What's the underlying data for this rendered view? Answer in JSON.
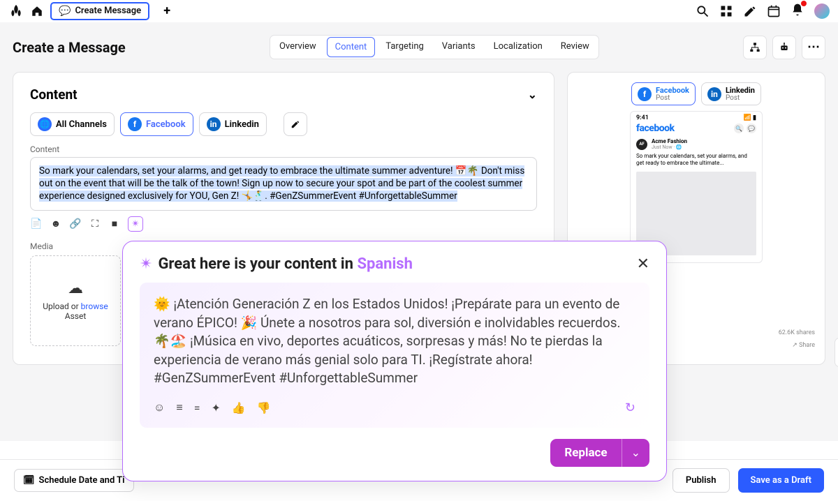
{
  "topbar": {
    "tab_label": "Create Message"
  },
  "page": {
    "title": "Create a Message"
  },
  "nav": {
    "tabs": [
      "Overview",
      "Content",
      "Targeting",
      "Variants",
      "Localization",
      "Review"
    ],
    "active": 1
  },
  "content_card": {
    "heading": "Content",
    "channels": {
      "all_label": "All Channels",
      "fb_label": "Facebook",
      "li_label": "Linkedin"
    },
    "field_label": "Content",
    "message": "So mark your calendars, set your alarms, and get ready to embrace the ultimate summer adventure! 📅🌴 Don't miss out on the event that will be the talk of the town! Sign up now to secure your spot and be part of the coolest summer experience designed exclusively for YOU, Gen Z! 🤸🕺. #GenZSummerEvent #UnforgettableSummer",
    "media_label": "Media",
    "upload_prefix": "Upload or ",
    "upload_link": "browse",
    "upload_suffix": "Asset"
  },
  "preview": {
    "fb_tab": {
      "line1": "Facebook",
      "line2": "Post"
    },
    "li_tab": {
      "line1": "Linkedin",
      "line2": "Post"
    },
    "phone": {
      "time": "9:41",
      "logo": "facebook",
      "author": "Acme Fashion",
      "subline": "Just Now · 🌐",
      "body": "So mark your calendars, set your alarms, and get ready to embrace the ultimate..."
    },
    "reach": "62.6K shares",
    "share_label": "Share"
  },
  "ai": {
    "title_prefix": "Great here is your content in ",
    "title_lang": "Spanish",
    "body": "🌞 ¡Atención Generación Z en los Estados Unidos! ¡Prepárate para un evento de verano ÉPICO! 🎉 Únete a nosotros para sol, diversión e inolvidables recuerdos. 🌴🏖️ ¡Música en vivo, deportes acuáticos, sorpresas y más! No te pierdas la experiencia de verano más genial solo para TI. ¡Regístrate ahora! #GenZSummerEvent #UnforgettableSummer",
    "replace_label": "Replace"
  },
  "bottom": {
    "schedule_label": "Schedule Date and Ti",
    "publish_label": "Publish",
    "draft_label": "Save as a Draft"
  }
}
